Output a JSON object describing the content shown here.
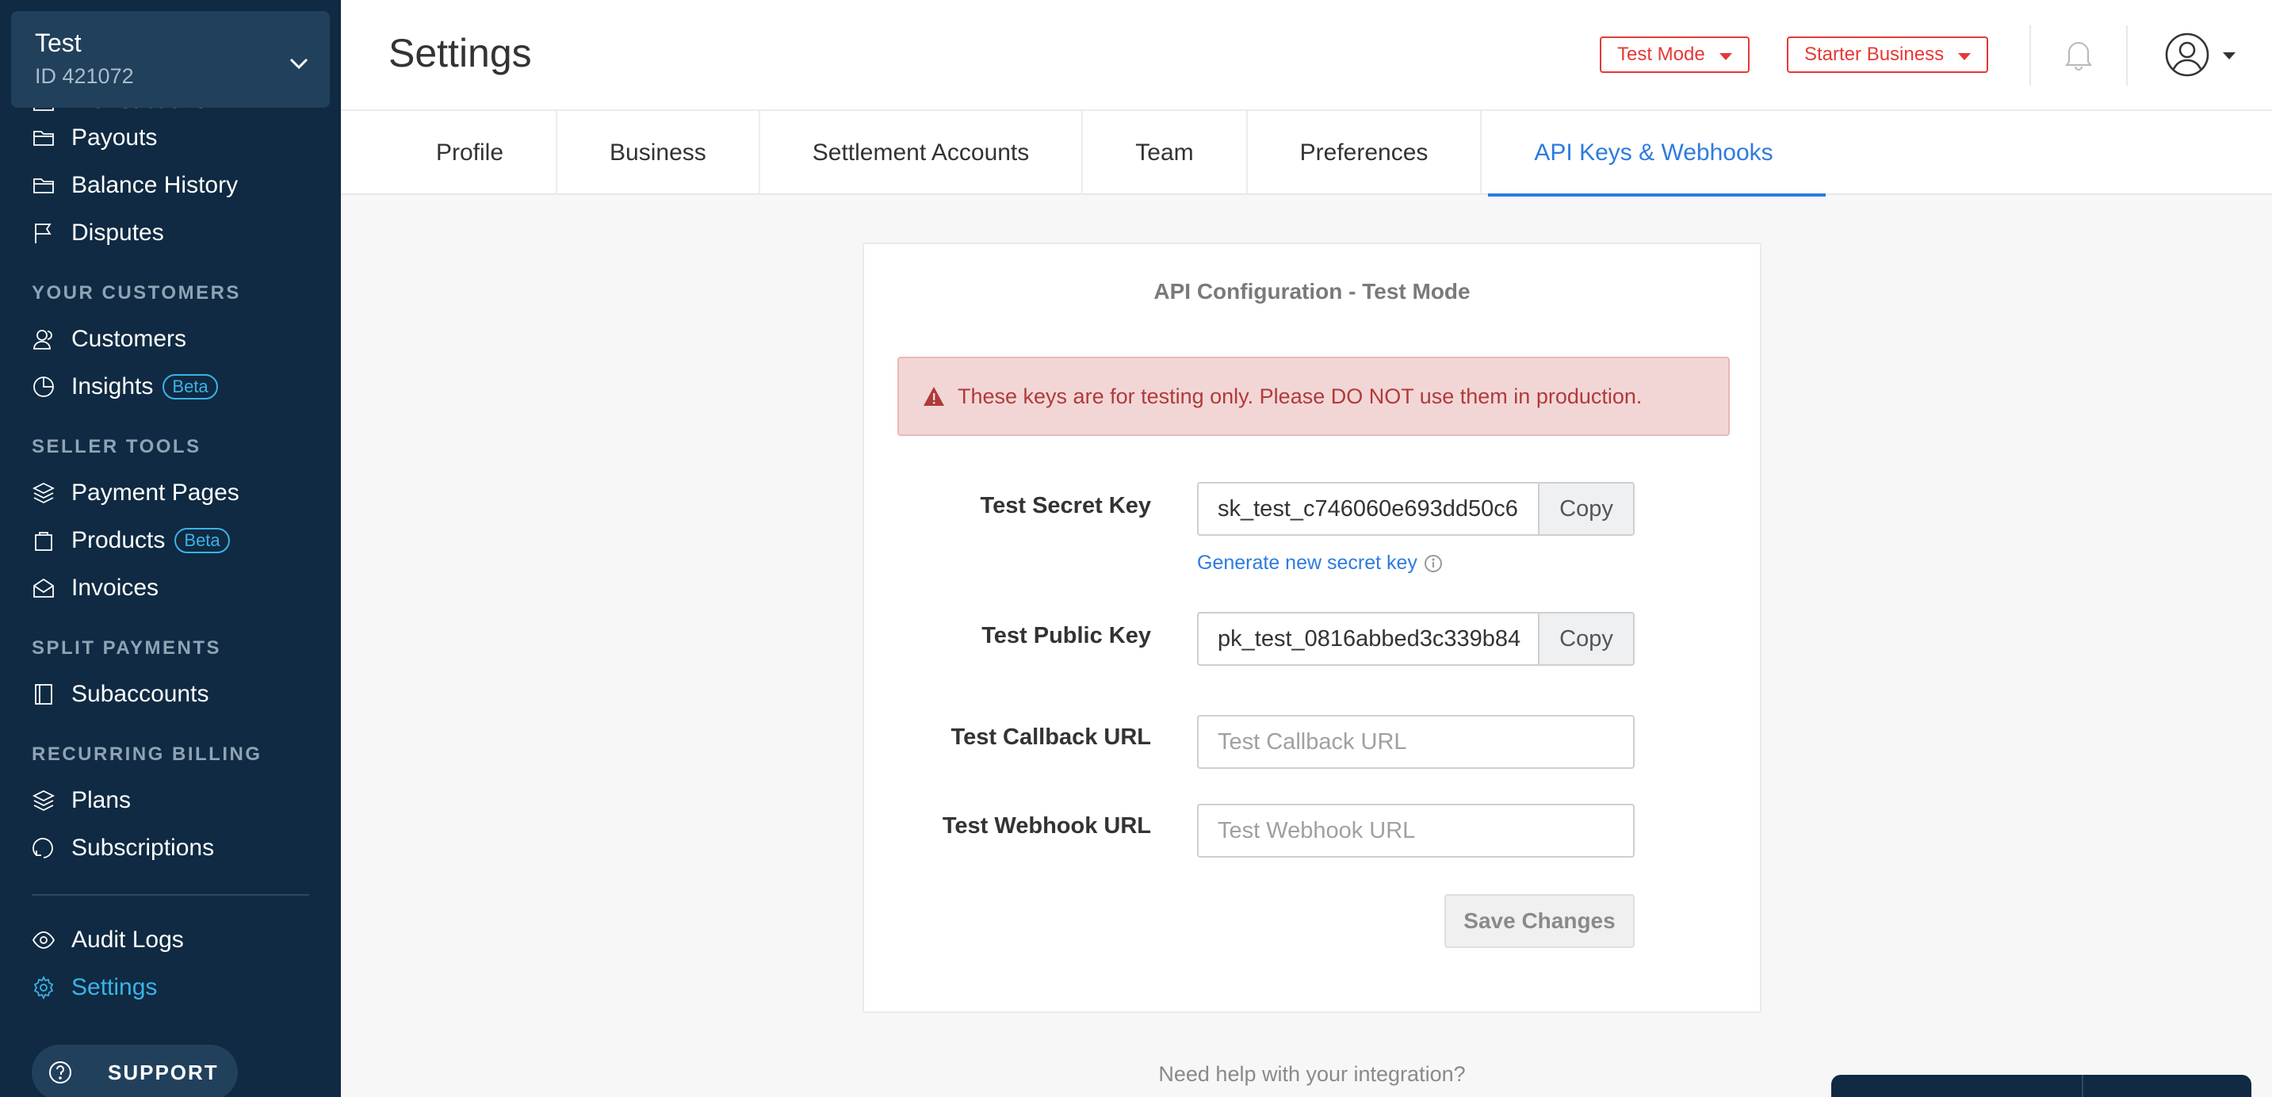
{
  "account": {
    "name": "Test",
    "id_label": "ID 421072"
  },
  "sidebar": {
    "partial_item": "Transactions",
    "items_top": [
      {
        "label": "Payouts",
        "icon": "folder-icon"
      },
      {
        "label": "Balance History",
        "icon": "folder-icon"
      },
      {
        "label": "Disputes",
        "icon": "flag-icon"
      }
    ],
    "sections": {
      "customers": "YOUR CUSTOMERS",
      "seller_tools": "SELLER TOOLS",
      "split_payments": "SPLIT PAYMENTS",
      "recurring_billing": "RECURRING BILLING"
    },
    "customers_items": [
      {
        "label": "Customers",
        "icon": "users-icon"
      },
      {
        "label": "Insights",
        "icon": "chart-icon",
        "badge": "Beta"
      }
    ],
    "seller_items": [
      {
        "label": "Payment Pages",
        "icon": "layers-icon"
      },
      {
        "label": "Products",
        "icon": "bag-icon",
        "badge": "Beta"
      },
      {
        "label": "Invoices",
        "icon": "envelope-icon"
      }
    ],
    "split_items": [
      {
        "label": "Subaccounts",
        "icon": "book-icon"
      }
    ],
    "recurring_items": [
      {
        "label": "Plans",
        "icon": "stack-icon"
      },
      {
        "label": "Subscriptions",
        "icon": "refresh-icon"
      }
    ],
    "bottom_items": [
      {
        "label": "Audit Logs",
        "icon": "eye-icon"
      },
      {
        "label": "Settings",
        "icon": "gear-icon",
        "active": true
      }
    ],
    "support_label": "SUPPORT"
  },
  "header": {
    "title": "Settings",
    "mode_button": "Test Mode",
    "plan_button": "Starter Business"
  },
  "tabs": [
    {
      "label": "Profile"
    },
    {
      "label": "Business"
    },
    {
      "label": "Settlement Accounts"
    },
    {
      "label": "Team"
    },
    {
      "label": "Preferences"
    },
    {
      "label": "API Keys & Webhooks",
      "active": true
    }
  ],
  "api_config": {
    "title": "API Configuration - Test Mode",
    "warning": "These keys are for testing only. Please DO NOT use them in production.",
    "secret_key_label": "Test Secret Key",
    "secret_key_value": "sk_test_c746060e693dd50c6",
    "public_key_label": "Test Public Key",
    "public_key_value": "pk_test_0816abbed3c339b84",
    "copy_label": "Copy",
    "generate_link": "Generate new secret key",
    "callback_label": "Test Callback URL",
    "callback_placeholder": "Test Callback URL",
    "webhook_label": "Test Webhook URL",
    "webhook_placeholder": "Test Webhook URL",
    "save_label": "Save Changes"
  },
  "footer": {
    "help_text": "Need help with your integration?"
  },
  "colors": {
    "sidebar_bg": "#0f2a42",
    "accent": "#2d7be0",
    "active_nav": "#3bb3e8",
    "danger": "#e53935",
    "alert_bg": "#f2d6d6"
  }
}
